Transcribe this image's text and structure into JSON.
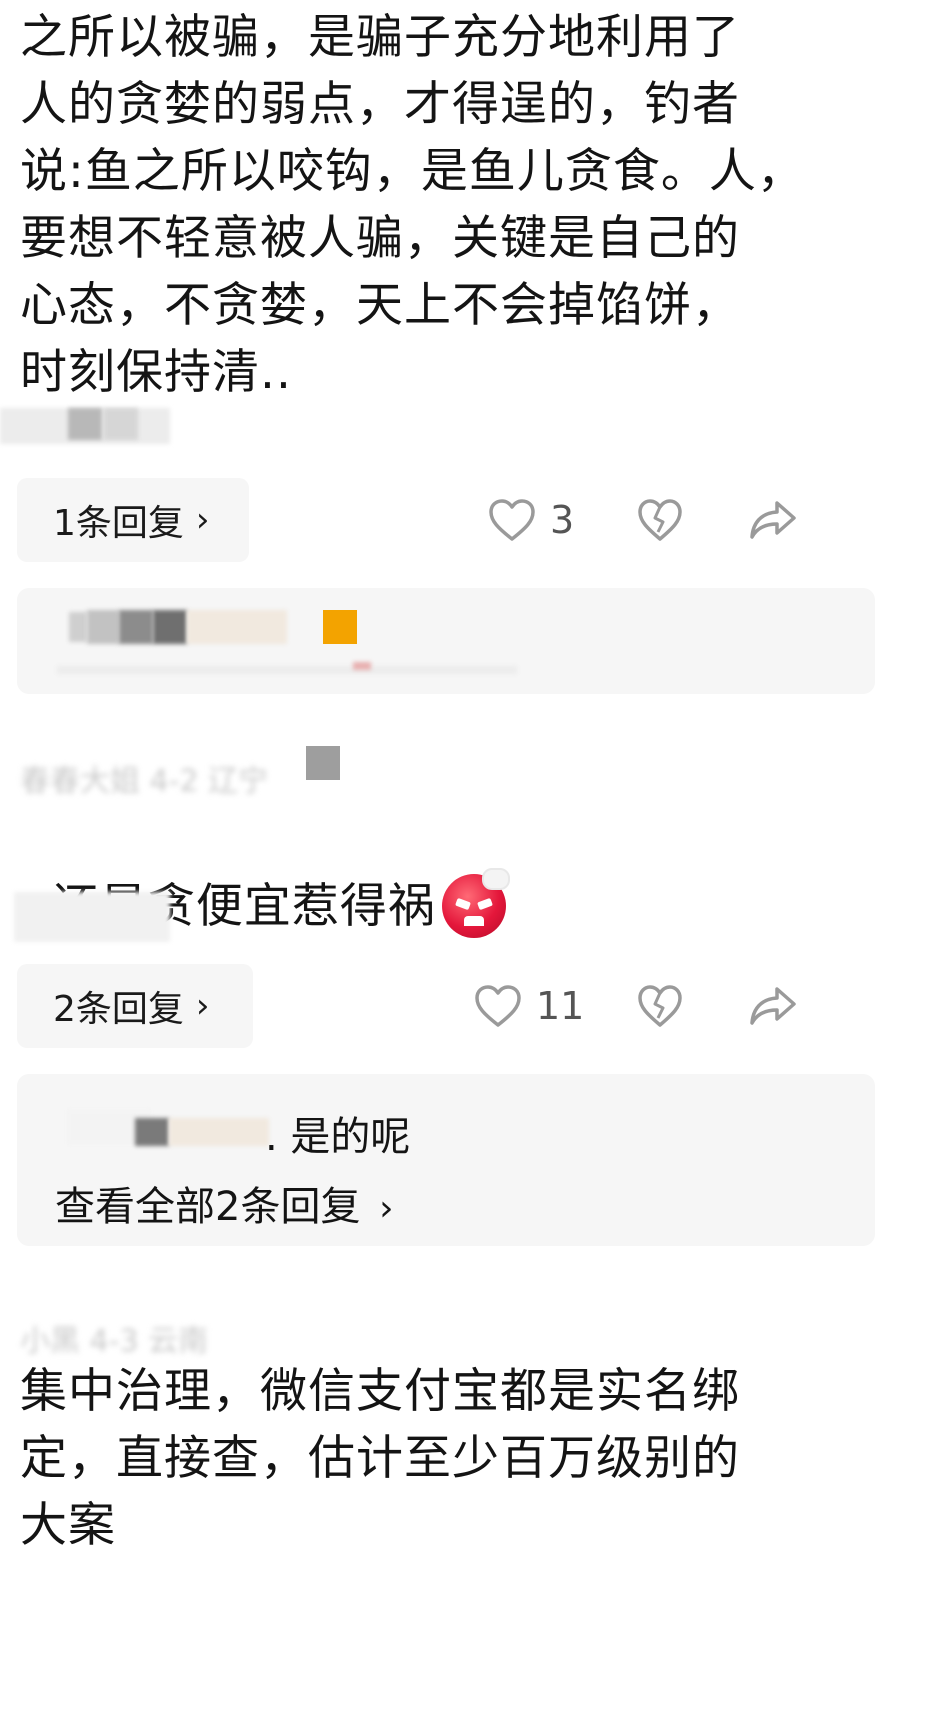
{
  "comments": [
    {
      "text": "之所以被骗，是骗子充分地利用了\n人的贪婪的弱点，才得逞的，钓者\n说:鱼之所以咬钩，是鱼儿贪食。人，\n要想不轻意被人骗，关键是自己的\n心态，不贪婪，天上不会掉馅饼，\n时刻保持清..",
      "reply_button": "1条回复",
      "like_count": "3"
    },
    {
      "meta": "春春大姐  4-2  辽宁",
      "text": "还是贪便宜惹得祸",
      "reply_button": "2条回复",
      "like_count": "11",
      "reply_preview": ". 是的呢",
      "view_all": "查看全部2条回复"
    },
    {
      "meta": "小黑  4-3  云南",
      "text": "集中治理，微信支付宝都是实名绑\n定，直接查，估计至少百万级别的\n大案"
    }
  ],
  "icons": {
    "like": "heart-outline-icon",
    "dislike": "broken-heart-icon",
    "share": "share-arrow-icon",
    "chevron": "chevron-right-icon",
    "emoji": "angry-face-emoji"
  },
  "colors": {
    "pill_bg": "#f6f6f6",
    "text": "#141414",
    "icon": "#9a9a9a",
    "muted": "#c9c9c9"
  }
}
